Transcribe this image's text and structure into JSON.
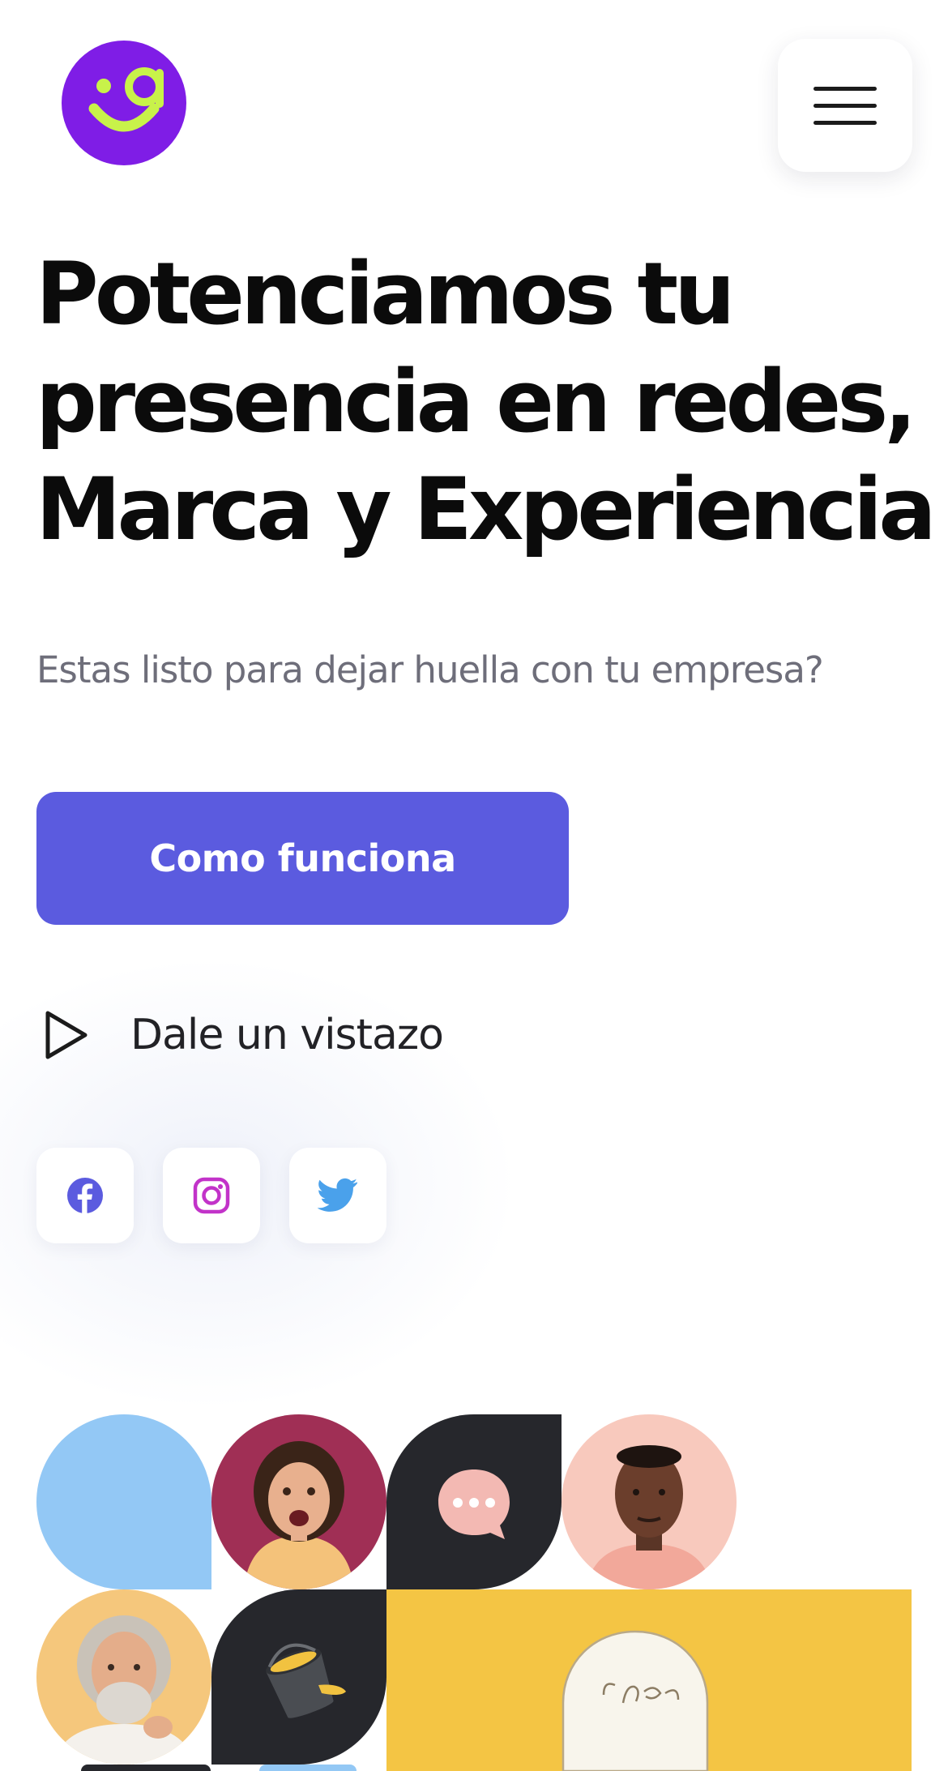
{
  "header": {
    "logo_icon": "smiley-a-logo-icon",
    "logo_color": "#7f1de6",
    "logo_accent": "#c8f24a",
    "menu_icon": "hamburger-menu-icon"
  },
  "hero": {
    "headline_line1": "Potenciamos tu",
    "headline_line2_start": "presencia en ",
    "headline_highlight": "redes",
    "headline_line2_end": ",",
    "headline_line3": "Marca y Experiencia",
    "subtitle": "Estas listo para dejar huella con tu empresa?",
    "cta_label": "Como funciona",
    "video_label": "Dale un vistazo",
    "video_icon": "play-icon"
  },
  "social": [
    {
      "icon": "facebook-icon",
      "color": "#5b5bdf"
    },
    {
      "icon": "instagram-icon",
      "color": "#c233c9"
    },
    {
      "icon": "twitter-icon",
      "color": "#4aa1eb"
    }
  ],
  "mosaic": {
    "tiles": [
      {
        "name": "blue-leaf-shape",
        "color": "#93c8f5"
      },
      {
        "name": "surprised-woman-photo",
        "color": "#a02f55"
      },
      {
        "name": "chat-bubble-icon",
        "color": "#26272c"
      },
      {
        "name": "smiling-man-photo",
        "color": "#f8c9bd"
      },
      {
        "name": "bearded-man-photo",
        "color": "#f5c77c"
      },
      {
        "name": "paint-bucket-icon",
        "color": "#26272c"
      },
      {
        "name": "lightbulb-idea-icon",
        "color": "#f4c544"
      }
    ],
    "idea_text": "idea"
  },
  "colors": {
    "accent": "#5b5bdf",
    "highlight": "#f7de86",
    "text": "#0b0b0b",
    "muted": "#6e6e7a"
  }
}
